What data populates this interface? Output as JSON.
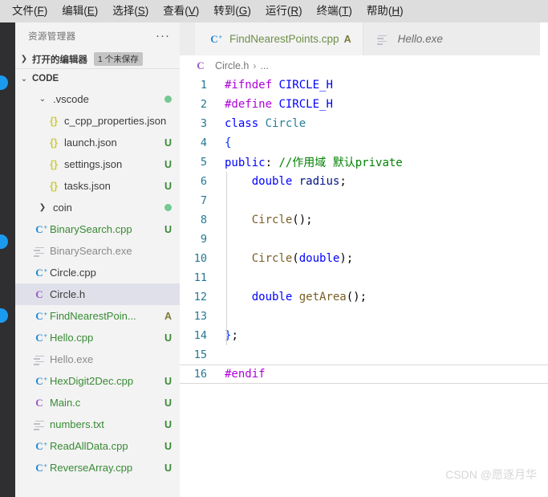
{
  "menubar": {
    "items": [
      {
        "text": "文件",
        "mnemonic": "F"
      },
      {
        "text": "编辑",
        "mnemonic": "E"
      },
      {
        "text": "选择",
        "mnemonic": "S"
      },
      {
        "text": "查看",
        "mnemonic": "V"
      },
      {
        "text": "转到",
        "mnemonic": "G"
      },
      {
        "text": "运行",
        "mnemonic": "R"
      },
      {
        "text": "终端",
        "mnemonic": "T"
      },
      {
        "text": "帮助",
        "mnemonic": "H"
      }
    ]
  },
  "sidebar": {
    "title": "资源管理器",
    "more_icon": "ellipsis-icon",
    "open_editors": {
      "label": "打开的编辑器",
      "badge": "1 个未保存",
      "chevron": "chevron-right-icon"
    },
    "workspace": {
      "label": "CODE",
      "chevron": "chevron-down-icon"
    },
    "tree": [
      {
        "name": ".vscode",
        "type": "folder",
        "icon": "chevron-down-icon",
        "indent": 24,
        "status": "",
        "dot": true,
        "selected": false,
        "color": "normal"
      },
      {
        "name": "c_cpp_properties.json",
        "type": "json",
        "icon": "json-icon",
        "indent": 38,
        "status": "",
        "dot": false,
        "selected": false,
        "color": "normal"
      },
      {
        "name": "launch.json",
        "type": "json",
        "icon": "json-icon",
        "indent": 38,
        "status": "U",
        "dot": false,
        "selected": false,
        "color": "normal"
      },
      {
        "name": "settings.json",
        "type": "json",
        "icon": "json-icon",
        "indent": 38,
        "status": "U",
        "dot": false,
        "selected": false,
        "color": "normal"
      },
      {
        "name": "tasks.json",
        "type": "json",
        "icon": "json-icon",
        "indent": 38,
        "status": "U",
        "dot": false,
        "selected": false,
        "color": "normal"
      },
      {
        "name": "coin",
        "type": "folder",
        "icon": "chevron-right-icon",
        "indent": 24,
        "status": "",
        "dot": true,
        "selected": false,
        "color": "normal"
      },
      {
        "name": "BinarySearch.cpp",
        "type": "cpp",
        "icon": "cpp-file-icon",
        "indent": 20,
        "status": "U",
        "dot": false,
        "selected": false,
        "color": "green"
      },
      {
        "name": "BinarySearch.exe",
        "type": "exe",
        "icon": "text-lines-icon",
        "indent": 20,
        "status": "",
        "dot": false,
        "selected": false,
        "color": "gray"
      },
      {
        "name": "Circle.cpp",
        "type": "cpp",
        "icon": "cpp-file-icon",
        "indent": 20,
        "status": "",
        "dot": false,
        "selected": false,
        "color": "normal"
      },
      {
        "name": "Circle.h",
        "type": "cheader",
        "icon": "c-file-icon",
        "indent": 20,
        "status": "",
        "dot": false,
        "selected": true,
        "color": "normal"
      },
      {
        "name": "FindNearestPoin...",
        "type": "cpp",
        "icon": "cpp-file-icon",
        "indent": 20,
        "status": "A",
        "dot": false,
        "selected": false,
        "color": "green"
      },
      {
        "name": "Hello.cpp",
        "type": "cpp",
        "icon": "cpp-file-icon",
        "indent": 20,
        "status": "U",
        "dot": false,
        "selected": false,
        "color": "green"
      },
      {
        "name": "Hello.exe",
        "type": "exe",
        "icon": "text-lines-icon",
        "indent": 20,
        "status": "",
        "dot": false,
        "selected": false,
        "color": "gray"
      },
      {
        "name": "HexDigit2Dec.cpp",
        "type": "cpp",
        "icon": "cpp-file-icon",
        "indent": 20,
        "status": "U",
        "dot": false,
        "selected": false,
        "color": "green"
      },
      {
        "name": "Main.c",
        "type": "cfile",
        "icon": "c-file-icon",
        "indent": 20,
        "status": "U",
        "dot": false,
        "selected": false,
        "color": "green"
      },
      {
        "name": "numbers.txt",
        "type": "txt",
        "icon": "text-lines-icon",
        "indent": 20,
        "status": "U",
        "dot": false,
        "selected": false,
        "color": "green"
      },
      {
        "name": "ReadAllData.cpp",
        "type": "cpp",
        "icon": "cpp-file-icon",
        "indent": 20,
        "status": "U",
        "dot": false,
        "selected": false,
        "color": "green"
      },
      {
        "name": "ReverseArray.cpp",
        "type": "cpp",
        "icon": "cpp-file-icon",
        "indent": 20,
        "status": "U",
        "dot": false,
        "selected": false,
        "color": "green"
      }
    ]
  },
  "tabs": [
    {
      "label": "FindNearestPoints.cpp",
      "badge": "A",
      "icon": "cpp-file-icon",
      "active": true,
      "italic": false
    },
    {
      "label": "Hello.exe",
      "badge": "",
      "icon": "text-lines-icon",
      "active": false,
      "italic": true
    }
  ],
  "breadcrumb": {
    "icon": "c-file-icon",
    "file": "Circle.h",
    "separator": "›",
    "rest": "..."
  },
  "code": {
    "language": "cpp",
    "current_line": 16,
    "lines": [
      {
        "n": "1",
        "tokens": [
          {
            "t": "#ifndef ",
            "c": "t-pre"
          },
          {
            "t": "CIRCLE_H",
            "c": "t-mac"
          }
        ]
      },
      {
        "n": "2",
        "tokens": [
          {
            "t": "#define ",
            "c": "t-pre"
          },
          {
            "t": "CIRCLE_H",
            "c": "t-mac"
          }
        ]
      },
      {
        "n": "3",
        "tokens": [
          {
            "t": "class ",
            "c": "t-kw"
          },
          {
            "t": "Circle",
            "c": "t-cls"
          }
        ]
      },
      {
        "n": "4",
        "tokens": [
          {
            "t": "{",
            "c": "t-brc"
          }
        ]
      },
      {
        "n": "5",
        "tokens": [
          {
            "t": "public",
            "c": "t-kw"
          },
          {
            "t": ": ",
            "c": "t-pun"
          },
          {
            "t": "//作用域 默认private",
            "c": "t-cmt"
          }
        ]
      },
      {
        "n": "6",
        "tokens": [
          {
            "t": "    ",
            "c": "t-pun"
          },
          {
            "t": "double ",
            "c": "t-kw"
          },
          {
            "t": "radius",
            "c": "t-var"
          },
          {
            "t": ";",
            "c": "t-pun"
          }
        ]
      },
      {
        "n": "7",
        "tokens": []
      },
      {
        "n": "8",
        "tokens": [
          {
            "t": "    ",
            "c": "t-pun"
          },
          {
            "t": "Circle",
            "c": "t-fn"
          },
          {
            "t": "();",
            "c": "t-pun"
          }
        ]
      },
      {
        "n": "9",
        "tokens": []
      },
      {
        "n": "10",
        "tokens": [
          {
            "t": "    ",
            "c": "t-pun"
          },
          {
            "t": "Circle",
            "c": "t-fn"
          },
          {
            "t": "(",
            "c": "t-pun"
          },
          {
            "t": "double",
            "c": "t-kw"
          },
          {
            "t": ");",
            "c": "t-pun"
          }
        ]
      },
      {
        "n": "11",
        "tokens": []
      },
      {
        "n": "12",
        "tokens": [
          {
            "t": "    ",
            "c": "t-pun"
          },
          {
            "t": "double ",
            "c": "t-kw"
          },
          {
            "t": "getArea",
            "c": "t-fn"
          },
          {
            "t": "();",
            "c": "t-pun"
          }
        ]
      },
      {
        "n": "13",
        "tokens": []
      },
      {
        "n": "14",
        "tokens": [
          {
            "t": "}",
            "c": "t-brc"
          },
          {
            "t": ";",
            "c": "t-pun"
          }
        ]
      },
      {
        "n": "15",
        "tokens": []
      },
      {
        "n": "16",
        "tokens": [
          {
            "t": "#endif",
            "c": "t-pre"
          }
        ]
      }
    ]
  },
  "watermark": "CSDN @愿逐月华",
  "colors": {
    "menubar_bg": "#dddddd",
    "sidebar_bg": "#f3f3f3",
    "activitybar_bg": "#2f2f32",
    "tabbar_bg": "#ececec",
    "active_tab_bg": "#f3f3f3",
    "selection_bg": "#e0e0eb",
    "git_modified": "#388a34",
    "git_added": "#7a7a3a",
    "folder_dot": "#73c991",
    "linenumber": "#237893"
  }
}
